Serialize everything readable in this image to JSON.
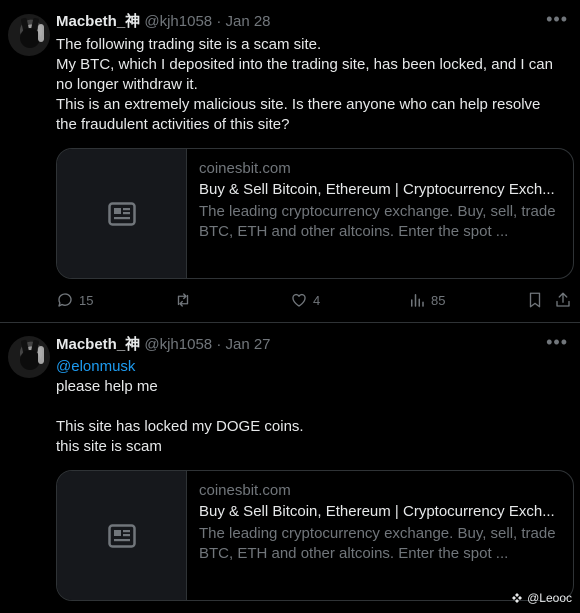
{
  "tweets": [
    {
      "author": {
        "name": "Macbeth_神",
        "handle": "@kjh1058"
      },
      "separator": "·",
      "date": "Jan 28",
      "lines": [
        "The following trading site is a scam site.",
        "My BTC, which I deposited into the trading site, has been locked, and I can",
        "no longer withdraw it.",
        "This is an extremely malicious site. Is there anyone who can help resolve",
        "the fraudulent activities of this site?"
      ],
      "card": {
        "domain": "coinesbit.com",
        "title": "Buy & Sell Bitcoin, Ethereum | Cryptocurrency Exch...",
        "description": "The leading cryptocurrency exchange. Buy, sell, trade BTC, ETH and other altcoins. Enter the spot ..."
      },
      "stats": {
        "replies": "15",
        "reposts": "",
        "likes": "4",
        "views": "85"
      }
    },
    {
      "author": {
        "name": "Macbeth_神",
        "handle": "@kjh1058"
      },
      "separator": "·",
      "date": "Jan 27",
      "mention": "@elonmusk",
      "lines": [
        "please help me",
        "",
        "This site has locked my DOGE coins.",
        "this site is scam"
      ],
      "card": {
        "domain": "coinesbit.com",
        "title": "Buy & Sell Bitcoin, Ethereum | Cryptocurrency Exch...",
        "description": "The leading cryptocurrency exchange. Buy, sell, trade BTC, ETH and other altcoins. Enter the spot ..."
      }
    }
  ],
  "watermark": "@Leooc",
  "colors": {
    "background": "#000000",
    "text": "#e7e9ea",
    "muted": "#71767b",
    "link": "#1d9bf0",
    "border": "#2f3336"
  }
}
